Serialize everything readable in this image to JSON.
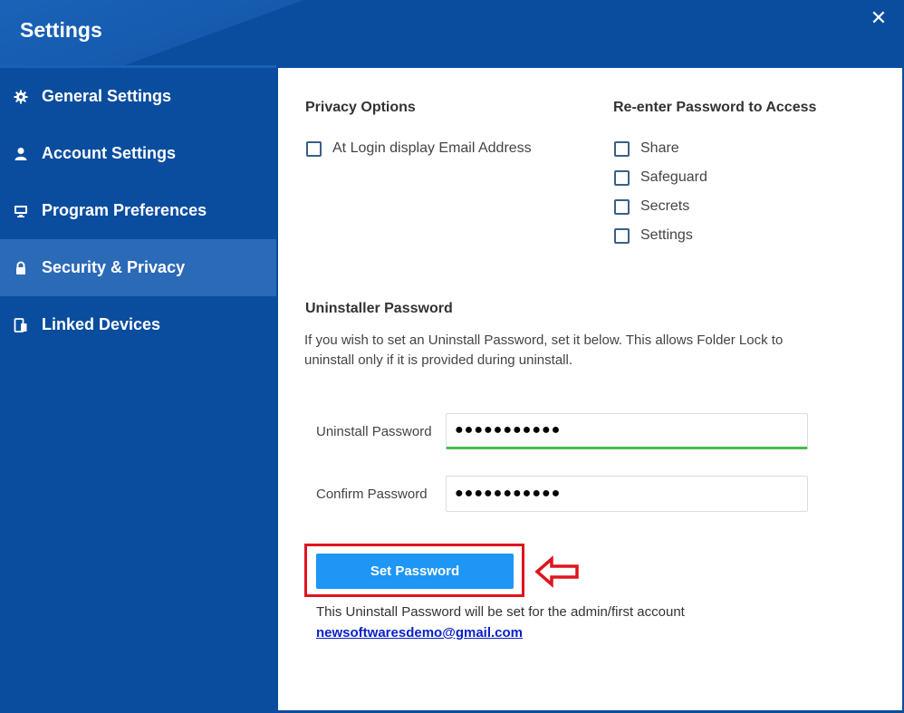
{
  "window": {
    "title": "Settings",
    "close_glyph": "✕"
  },
  "sidebar": {
    "items": [
      {
        "label": "General Settings",
        "icon": "gear-icon",
        "active": false
      },
      {
        "label": "Account Settings",
        "icon": "user-icon",
        "active": false
      },
      {
        "label": "Program Preferences",
        "icon": "monitor-icon",
        "active": false
      },
      {
        "label": "Security & Privacy",
        "icon": "lock-icon",
        "active": true
      },
      {
        "label": "Linked Devices",
        "icon": "devices-icon",
        "active": false
      }
    ]
  },
  "privacy": {
    "heading": "Privacy Options",
    "options": [
      {
        "label": "At Login display Email Address",
        "checked": false
      }
    ]
  },
  "reenter": {
    "heading": "Re-enter Password to Access",
    "options": [
      {
        "label": "Share",
        "checked": false
      },
      {
        "label": "Safeguard",
        "checked": false
      },
      {
        "label": "Secrets",
        "checked": false
      },
      {
        "label": "Settings",
        "checked": false
      }
    ]
  },
  "uninstaller": {
    "heading": "Uninstaller Password",
    "description": "If you wish to set an Uninstall Password, set it below. This allows Folder Lock to uninstall only if it is provided during uninstall.",
    "uninstall_label": "Uninstall Password",
    "uninstall_value": "●●●●●●●●●●●",
    "confirm_label": "Confirm Password",
    "confirm_value": "●●●●●●●●●●●",
    "button_label": "Set Password",
    "note": "This Uninstall Password will be set for the admin/first account",
    "email": "newsoftwaresdemo@gmail.com"
  },
  "colors": {
    "sidebar_bg": "#0a4d9e",
    "active_item": "#2a6ab7",
    "button": "#1e96f5",
    "highlight": "#e0131f",
    "valid_underline": "#4cba4c"
  }
}
